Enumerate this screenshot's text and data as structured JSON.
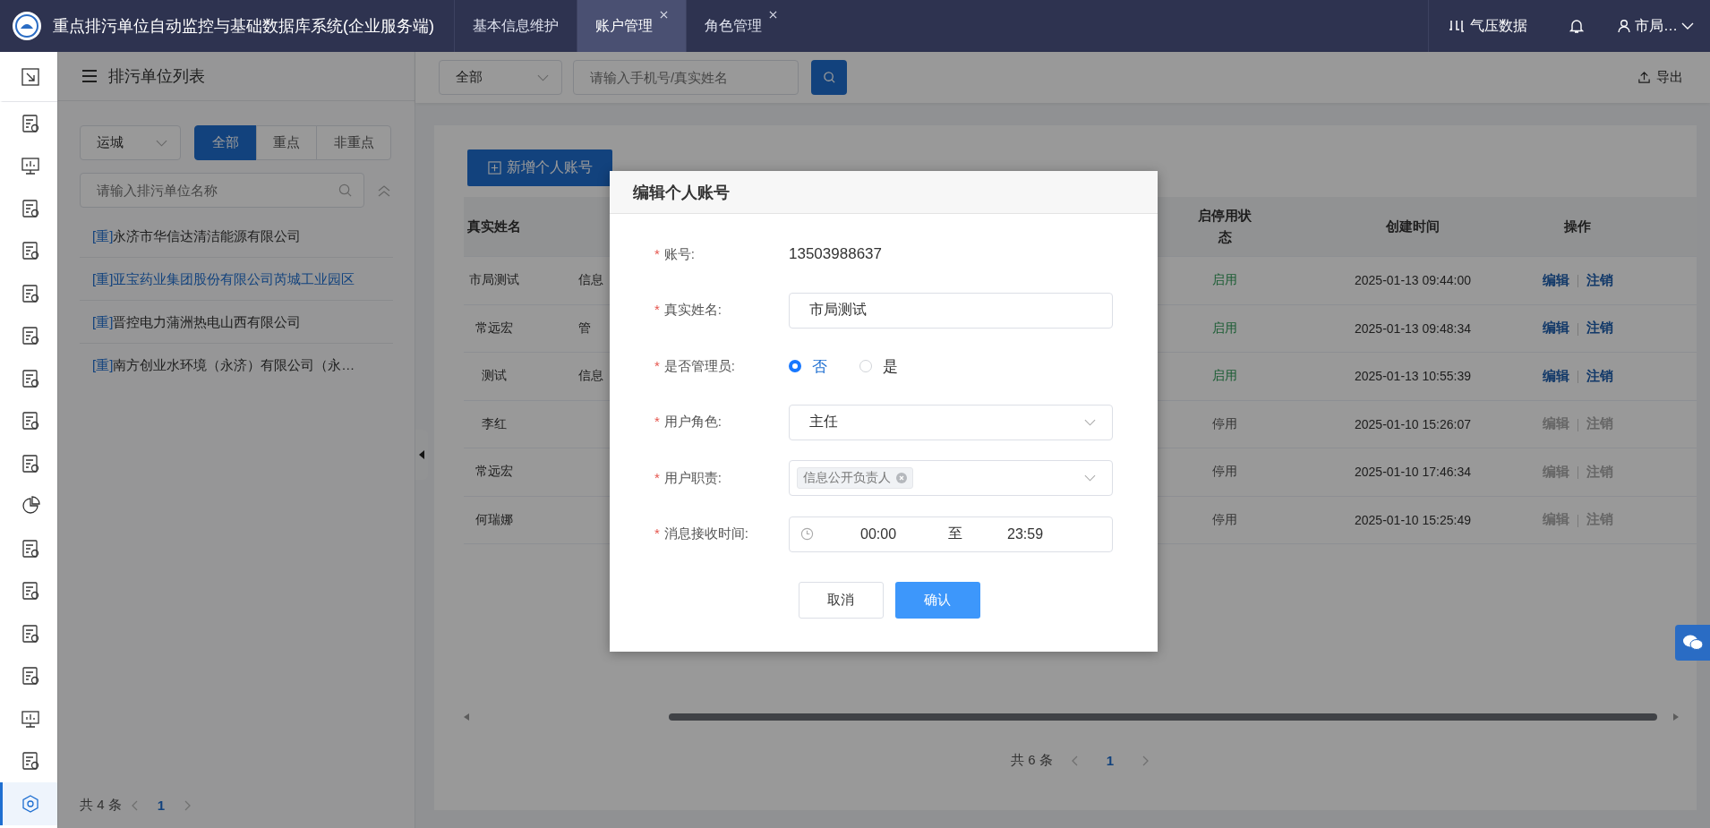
{
  "header": {
    "title": "重点排污单位自动监控与基础数据库系统(企业服务端)",
    "tabs": [
      {
        "label": "基本信息维护",
        "selected": false,
        "closable": false
      },
      {
        "label": "账户管理",
        "selected": true,
        "closable": true
      },
      {
        "label": "角色管理",
        "selected": false,
        "closable": true
      }
    ],
    "data_link": "气压数据",
    "user": "市局…"
  },
  "sidebar": {
    "items": [
      {
        "selected": false
      },
      {
        "selected": false
      },
      {
        "selected": false
      },
      {
        "selected": false
      },
      {
        "selected": false
      },
      {
        "selected": false
      },
      {
        "selected": false
      },
      {
        "selected": false
      },
      {
        "selected": false
      },
      {
        "selected": false
      },
      {
        "selected": false
      },
      {
        "selected": false
      },
      {
        "selected": false
      },
      {
        "selected": false
      },
      {
        "selected": false
      },
      {
        "selected": false
      },
      {
        "selected": false
      },
      {
        "selected": true
      }
    ]
  },
  "unit_panel": {
    "title": "排污单位列表",
    "region": "运城",
    "filters": [
      {
        "label": "全部",
        "selected": true
      },
      {
        "label": "重点",
        "selected": false
      },
      {
        "label": "非重点",
        "selected": false
      }
    ],
    "search_placeholder": "请输入排污单位名称",
    "units": [
      {
        "tag": "[重]",
        "name": "永济市华信达清洁能源有限公司",
        "selected": false
      },
      {
        "tag": "[重]",
        "name": "亚宝药业集团股份有限公司芮城工业园区",
        "selected": true
      },
      {
        "tag": "[重]",
        "name": "晋控电力蒲洲热电山西有限公司",
        "selected": false
      },
      {
        "tag": "[重]",
        "name": "南方创业水环境（永济）有限公司（永…",
        "selected": false
      }
    ],
    "total": "共 4 条",
    "page": "1"
  },
  "toolbar": {
    "scope": "全部",
    "search_placeholder": "请输入手机号/真实姓名",
    "export": "导出"
  },
  "accounts": {
    "add_button": "新增个人账号",
    "columns": [
      "真实姓名",
      "启停用状态",
      "创建时间",
      "操作"
    ],
    "rows": [
      {
        "name": "市局测试",
        "column_2": "信息",
        "status": "启用",
        "enabled": true,
        "created": "2025-01-13 09:44:00",
        "actions": [
          "编辑",
          "注销"
        ]
      },
      {
        "name": "常远宏",
        "column_2": "管",
        "status": "启用",
        "enabled": true,
        "created": "2025-01-13 09:48:34",
        "actions": [
          "编辑",
          "注销"
        ]
      },
      {
        "name": "测试",
        "column_2": "信息",
        "status": "启用",
        "enabled": true,
        "created": "2025-01-13 10:55:39",
        "actions": [
          "编辑",
          "注销"
        ]
      },
      {
        "name": "李红",
        "status": "停用",
        "enabled": false,
        "created": "2025-01-10 15:26:07",
        "actions": [
          "编辑",
          "注销"
        ]
      },
      {
        "name": "常远宏",
        "status": "停用",
        "enabled": false,
        "created": "2025-01-10 17:46:34",
        "actions": [
          "编辑",
          "注销"
        ]
      },
      {
        "name": "何瑞娜",
        "status": "停用",
        "enabled": false,
        "created": "2025-01-10 15:25:49",
        "actions": [
          "编辑",
          "注销"
        ]
      }
    ],
    "total": "共 6 条",
    "page": "1"
  },
  "dialog": {
    "title": "编辑个人账号",
    "fields": [
      {
        "kind": "text",
        "required_mark": "*",
        "label": "账号:",
        "value": "13503988637"
      },
      {
        "kind": "input",
        "required_mark": "*",
        "label": "真实姓名:",
        "value": "市局测试"
      },
      {
        "kind": "radio",
        "required_mark": "*",
        "label": "是否管理员:",
        "options": [
          {
            "label": "否",
            "selected": true
          },
          {
            "label": "是",
            "selected": false
          }
        ]
      },
      {
        "kind": "select",
        "required_mark": "*",
        "label": "用户角色:",
        "value": "主任"
      },
      {
        "kind": "tags",
        "required_mark": "*",
        "label": "用户职责:",
        "tags": [
          "信息公开负责人"
        ]
      },
      {
        "kind": "time_range",
        "required_mark": "*",
        "label": "消息接收时间:",
        "start": "00:00",
        "separator": "至",
        "end": "23:59"
      }
    ],
    "cancel": "取消",
    "confirm": "确认"
  }
}
